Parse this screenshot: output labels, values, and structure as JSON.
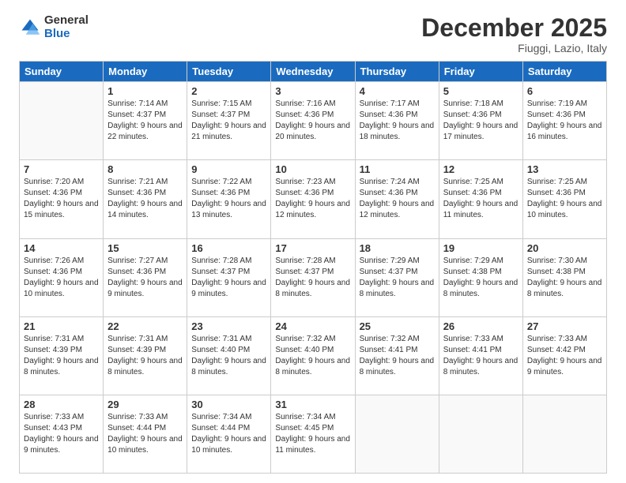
{
  "logo": {
    "general": "General",
    "blue": "Blue"
  },
  "header": {
    "month": "December 2025",
    "location": "Fiuggi, Lazio, Italy"
  },
  "weekdays": [
    "Sunday",
    "Monday",
    "Tuesday",
    "Wednesday",
    "Thursday",
    "Friday",
    "Saturday"
  ],
  "weeks": [
    [
      {
        "day": "",
        "sunrise": "",
        "sunset": "",
        "daylight": ""
      },
      {
        "day": "1",
        "sunrise": "Sunrise: 7:14 AM",
        "sunset": "Sunset: 4:37 PM",
        "daylight": "Daylight: 9 hours and 22 minutes."
      },
      {
        "day": "2",
        "sunrise": "Sunrise: 7:15 AM",
        "sunset": "Sunset: 4:37 PM",
        "daylight": "Daylight: 9 hours and 21 minutes."
      },
      {
        "day": "3",
        "sunrise": "Sunrise: 7:16 AM",
        "sunset": "Sunset: 4:36 PM",
        "daylight": "Daylight: 9 hours and 20 minutes."
      },
      {
        "day": "4",
        "sunrise": "Sunrise: 7:17 AM",
        "sunset": "Sunset: 4:36 PM",
        "daylight": "Daylight: 9 hours and 18 minutes."
      },
      {
        "day": "5",
        "sunrise": "Sunrise: 7:18 AM",
        "sunset": "Sunset: 4:36 PM",
        "daylight": "Daylight: 9 hours and 17 minutes."
      },
      {
        "day": "6",
        "sunrise": "Sunrise: 7:19 AM",
        "sunset": "Sunset: 4:36 PM",
        "daylight": "Daylight: 9 hours and 16 minutes."
      }
    ],
    [
      {
        "day": "7",
        "sunrise": "Sunrise: 7:20 AM",
        "sunset": "Sunset: 4:36 PM",
        "daylight": "Daylight: 9 hours and 15 minutes."
      },
      {
        "day": "8",
        "sunrise": "Sunrise: 7:21 AM",
        "sunset": "Sunset: 4:36 PM",
        "daylight": "Daylight: 9 hours and 14 minutes."
      },
      {
        "day": "9",
        "sunrise": "Sunrise: 7:22 AM",
        "sunset": "Sunset: 4:36 PM",
        "daylight": "Daylight: 9 hours and 13 minutes."
      },
      {
        "day": "10",
        "sunrise": "Sunrise: 7:23 AM",
        "sunset": "Sunset: 4:36 PM",
        "daylight": "Daylight: 9 hours and 12 minutes."
      },
      {
        "day": "11",
        "sunrise": "Sunrise: 7:24 AM",
        "sunset": "Sunset: 4:36 PM",
        "daylight": "Daylight: 9 hours and 12 minutes."
      },
      {
        "day": "12",
        "sunrise": "Sunrise: 7:25 AM",
        "sunset": "Sunset: 4:36 PM",
        "daylight": "Daylight: 9 hours and 11 minutes."
      },
      {
        "day": "13",
        "sunrise": "Sunrise: 7:25 AM",
        "sunset": "Sunset: 4:36 PM",
        "daylight": "Daylight: 9 hours and 10 minutes."
      }
    ],
    [
      {
        "day": "14",
        "sunrise": "Sunrise: 7:26 AM",
        "sunset": "Sunset: 4:36 PM",
        "daylight": "Daylight: 9 hours and 10 minutes."
      },
      {
        "day": "15",
        "sunrise": "Sunrise: 7:27 AM",
        "sunset": "Sunset: 4:36 PM",
        "daylight": "Daylight: 9 hours and 9 minutes."
      },
      {
        "day": "16",
        "sunrise": "Sunrise: 7:28 AM",
        "sunset": "Sunset: 4:37 PM",
        "daylight": "Daylight: 9 hours and 9 minutes."
      },
      {
        "day": "17",
        "sunrise": "Sunrise: 7:28 AM",
        "sunset": "Sunset: 4:37 PM",
        "daylight": "Daylight: 9 hours and 8 minutes."
      },
      {
        "day": "18",
        "sunrise": "Sunrise: 7:29 AM",
        "sunset": "Sunset: 4:37 PM",
        "daylight": "Daylight: 9 hours and 8 minutes."
      },
      {
        "day": "19",
        "sunrise": "Sunrise: 7:29 AM",
        "sunset": "Sunset: 4:38 PM",
        "daylight": "Daylight: 9 hours and 8 minutes."
      },
      {
        "day": "20",
        "sunrise": "Sunrise: 7:30 AM",
        "sunset": "Sunset: 4:38 PM",
        "daylight": "Daylight: 9 hours and 8 minutes."
      }
    ],
    [
      {
        "day": "21",
        "sunrise": "Sunrise: 7:31 AM",
        "sunset": "Sunset: 4:39 PM",
        "daylight": "Daylight: 9 hours and 8 minutes."
      },
      {
        "day": "22",
        "sunrise": "Sunrise: 7:31 AM",
        "sunset": "Sunset: 4:39 PM",
        "daylight": "Daylight: 9 hours and 8 minutes."
      },
      {
        "day": "23",
        "sunrise": "Sunrise: 7:31 AM",
        "sunset": "Sunset: 4:40 PM",
        "daylight": "Daylight: 9 hours and 8 minutes."
      },
      {
        "day": "24",
        "sunrise": "Sunrise: 7:32 AM",
        "sunset": "Sunset: 4:40 PM",
        "daylight": "Daylight: 9 hours and 8 minutes."
      },
      {
        "day": "25",
        "sunrise": "Sunrise: 7:32 AM",
        "sunset": "Sunset: 4:41 PM",
        "daylight": "Daylight: 9 hours and 8 minutes."
      },
      {
        "day": "26",
        "sunrise": "Sunrise: 7:33 AM",
        "sunset": "Sunset: 4:41 PM",
        "daylight": "Daylight: 9 hours and 8 minutes."
      },
      {
        "day": "27",
        "sunrise": "Sunrise: 7:33 AM",
        "sunset": "Sunset: 4:42 PM",
        "daylight": "Daylight: 9 hours and 9 minutes."
      }
    ],
    [
      {
        "day": "28",
        "sunrise": "Sunrise: 7:33 AM",
        "sunset": "Sunset: 4:43 PM",
        "daylight": "Daylight: 9 hours and 9 minutes."
      },
      {
        "day": "29",
        "sunrise": "Sunrise: 7:33 AM",
        "sunset": "Sunset: 4:44 PM",
        "daylight": "Daylight: 9 hours and 10 minutes."
      },
      {
        "day": "30",
        "sunrise": "Sunrise: 7:34 AM",
        "sunset": "Sunset: 4:44 PM",
        "daylight": "Daylight: 9 hours and 10 minutes."
      },
      {
        "day": "31",
        "sunrise": "Sunrise: 7:34 AM",
        "sunset": "Sunset: 4:45 PM",
        "daylight": "Daylight: 9 hours and 11 minutes."
      },
      {
        "day": "",
        "sunrise": "",
        "sunset": "",
        "daylight": ""
      },
      {
        "day": "",
        "sunrise": "",
        "sunset": "",
        "daylight": ""
      },
      {
        "day": "",
        "sunrise": "",
        "sunset": "",
        "daylight": ""
      }
    ]
  ]
}
